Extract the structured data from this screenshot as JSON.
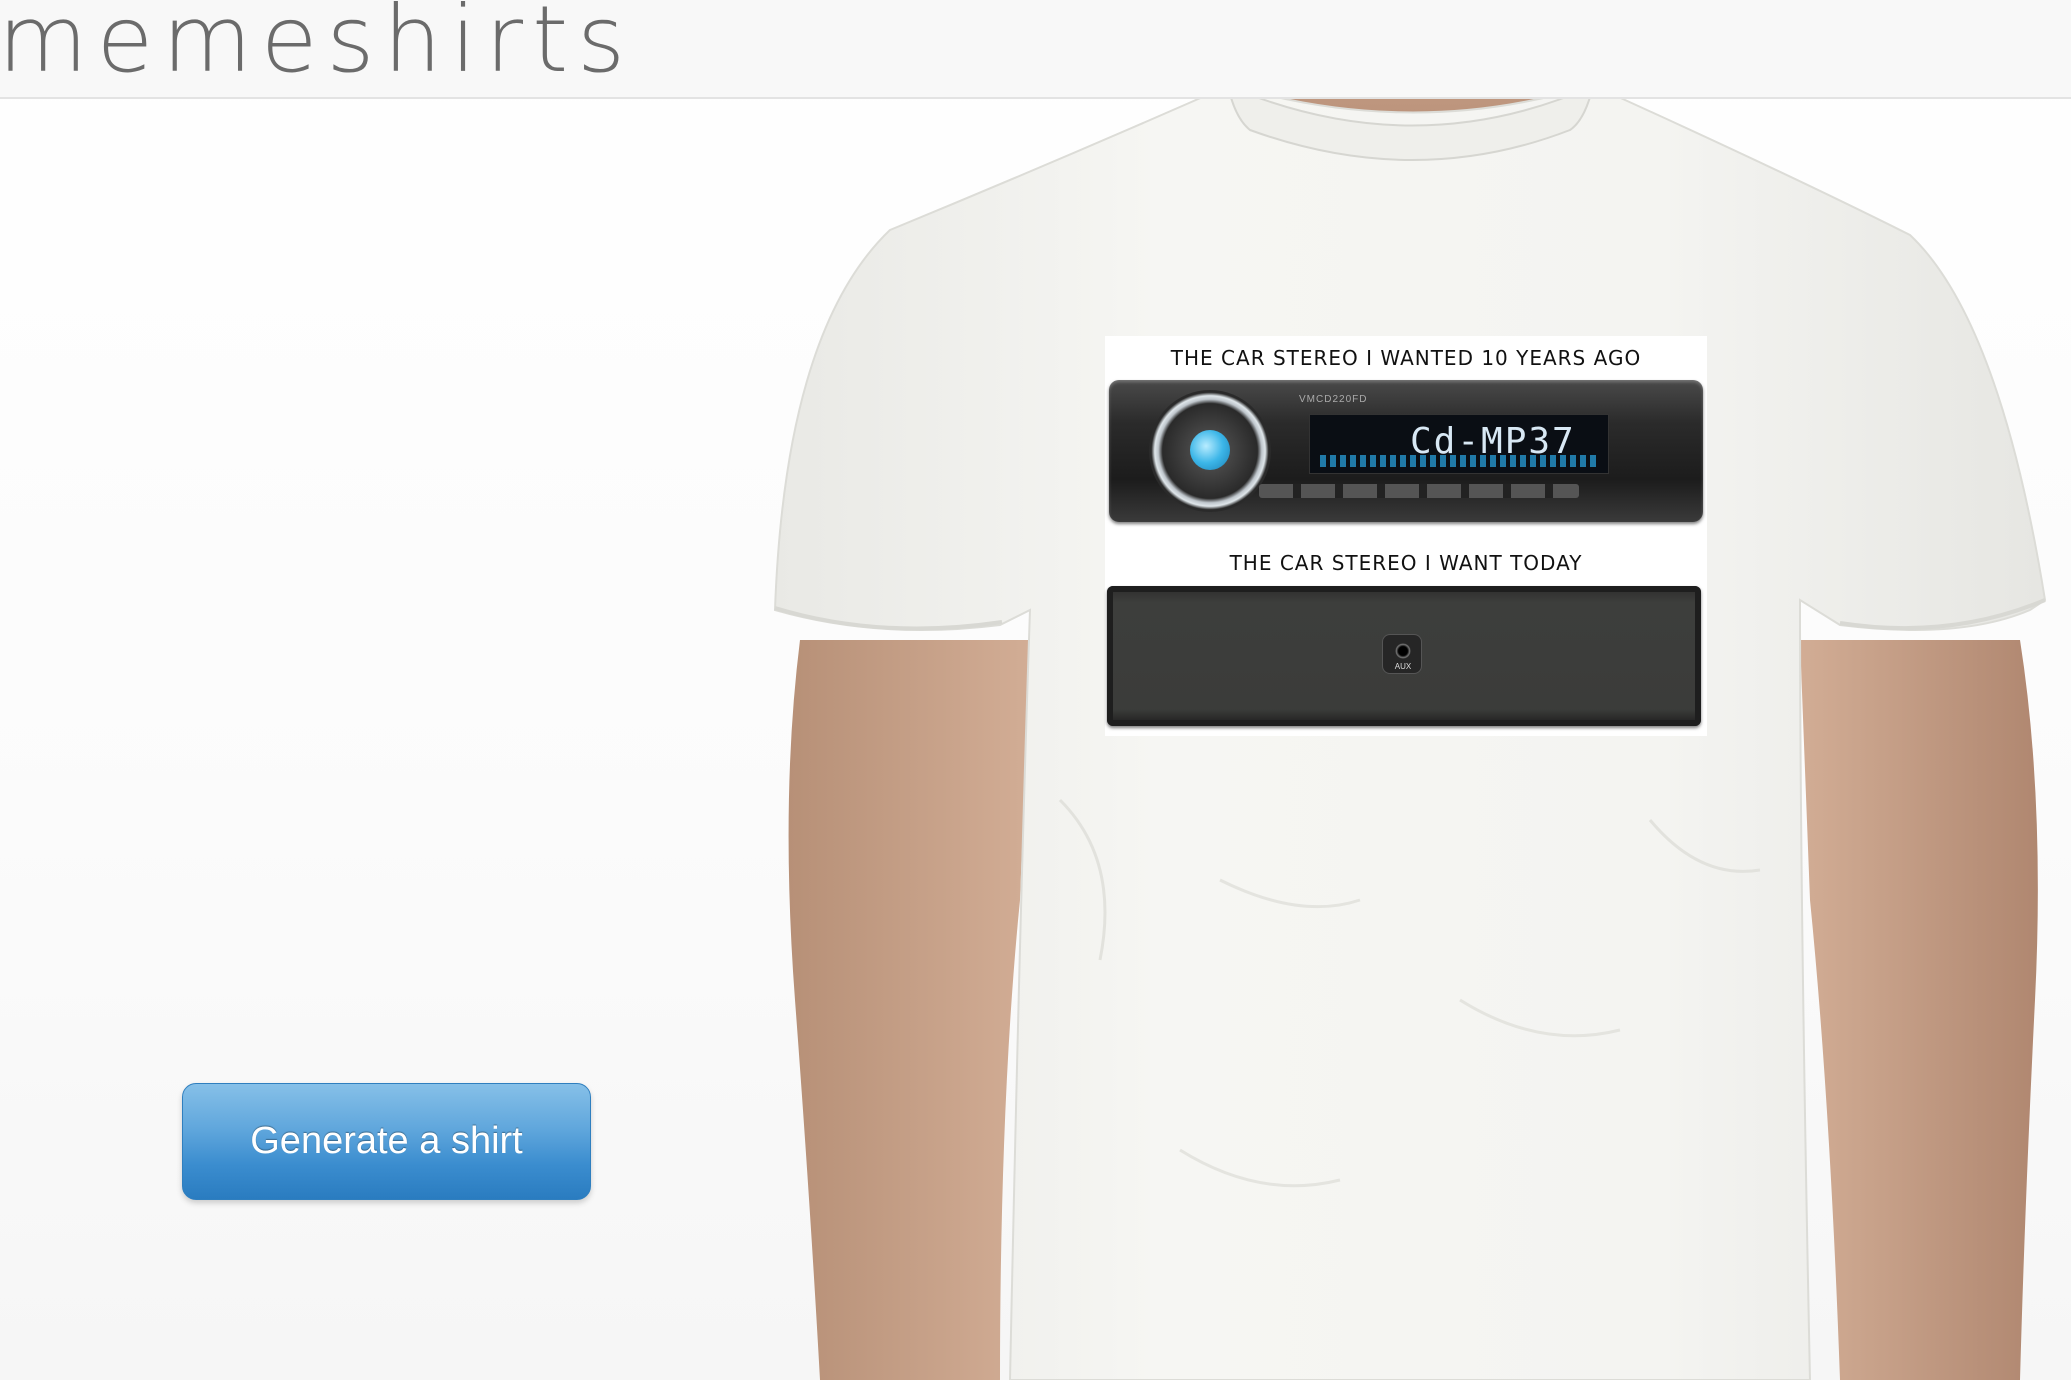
{
  "header": {
    "logo_text": "memeshirts"
  },
  "actions": {
    "generate_label": "Generate a shirt"
  },
  "meme": {
    "top_caption": "THE CAR STEREO I WANTED 10 YEARS AGO",
    "bottom_caption": "THE CAR STEREO I WANT TODAY",
    "old_stereo": {
      "model": "VMCD220FD",
      "display_text": "Cd-MP37"
    },
    "new_stereo": {
      "aux_label": "AUX"
    }
  },
  "colors": {
    "button_top": "#86c0e8",
    "button_bottom": "#2a7cc0",
    "logo": "#6b6b6b",
    "header_bg": "#f8f8f8"
  }
}
